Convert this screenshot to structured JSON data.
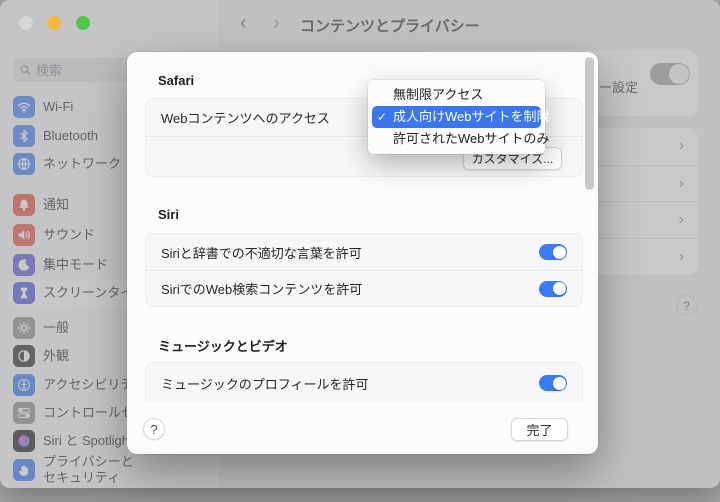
{
  "colors": {
    "menu_highlight": "#3b76f0",
    "toggle_on": "#3a7bf6",
    "traffic_red": "#d6d6d7",
    "traffic_yellow": "#f5b73d",
    "traffic_green": "#53c54c"
  },
  "titlebar": {
    "title": "コンテンツとプライバシー",
    "back_icon": "‹",
    "forward_icon": "›"
  },
  "sidebar": {
    "search_placeholder": "検索",
    "items": [
      {
        "label": "Wi-Fi",
        "color": "#3f80f7"
      },
      {
        "label": "Bluetooth",
        "color": "#3f80f7"
      },
      {
        "label": "ネットワーク",
        "color": "#3f80f7"
      },
      {
        "label": "通知",
        "color": "#eb4d3d"
      },
      {
        "label": "サウンド",
        "color": "#eb5545"
      },
      {
        "label": "集中モード",
        "color": "#5b5bd6"
      },
      {
        "label": "スクリーンタイム",
        "color": "#4f55da"
      },
      {
        "label": "一般",
        "color": "#8e8e93"
      },
      {
        "label": "外観",
        "color": "#2c2c2e"
      },
      {
        "label": "アクセシビリティ",
        "color": "#3478f6"
      },
      {
        "label": "コントロールセンター",
        "color": "#8e8e93"
      },
      {
        "label": "Siri と Spotlight",
        "color": "#1c1c1e"
      },
      {
        "label": "プライバシーと\nセキュリティ",
        "color": "#3478f6"
      }
    ]
  },
  "background_page": {
    "truncated_label": "ー設定",
    "chevron": "›",
    "help": "?"
  },
  "dialog": {
    "safari": {
      "header": "Safari",
      "row_label": "Webコンテンツへのアクセス",
      "customize_button": "カスタマイズ..."
    },
    "menu": {
      "check": "✓",
      "items": [
        "無制限アクセス",
        "成人向けWebサイトを制限",
        "許可されたWebサイトのみ"
      ],
      "selected_index": 1
    },
    "siri": {
      "header": "Siri",
      "rows": [
        {
          "label": "Siriと辞書での不適切な言葉を許可",
          "on": true
        },
        {
          "label": "SiriでのWeb検索コンテンツを許可",
          "on": true
        }
      ]
    },
    "music": {
      "header": "ミュージックとビデオ",
      "rows": [
        {
          "label": "ミュージックのプロフィールを許可",
          "on": true
        }
      ]
    },
    "footer": {
      "help": "?",
      "done": "完了"
    }
  }
}
